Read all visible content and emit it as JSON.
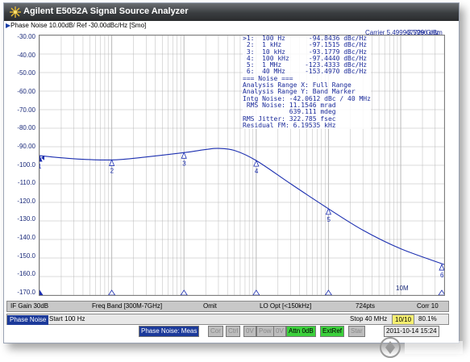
{
  "window": {
    "title": "Agilent E5052A Signal Source Analyzer"
  },
  "header": {
    "trace_label": "Phase Noise 10.00dB/ Ref -30.00dBc/Hz [Smo]"
  },
  "carrier": {
    "text": "Carrier 5.499967729 GHz",
    "power": "-3.5966 dBm"
  },
  "y_axis": {
    "ticks": [
      "-30.00",
      "-40.00",
      "-50.00",
      "-60.00",
      "-70.00",
      "-80.00",
      "-90.00",
      "-100.0",
      "-110.0",
      "-120.0",
      "-130.0",
      "-140.0",
      "-150.0",
      "-160.0",
      "-170.0"
    ]
  },
  "x_axis": {
    "tick_10M": "10M"
  },
  "readout_lines": [
    ">1:  100 Hz      -94.8436 dBc/Hz",
    " 2:  1 kHz       -97.1515 dBc/Hz",
    " 3:  10 kHz      -93.1779 dBc/Hz",
    " 4:  100 kHz     -97.4440 dBc/Hz",
    " 5:  1 MHz      -123.4333 dBc/Hz",
    " 6:  40 MHz     -153.4970 dBc/Hz",
    "=== Noise ===",
    "Analysis Range X: Full Range",
    "Analysis Range Y: Band Marker",
    "Intg Noise: -42.0612 dBc / 40 MHz",
    " RMS Noise: 11.1546 mrad",
    "            639.111 mdeg",
    "RMS Jitter: 322.785 fsec",
    "Residual FM: 6.19535 kHz"
  ],
  "markers": {
    "labels": [
      "1",
      "2",
      "3",
      "4",
      "5",
      "6"
    ],
    "offsets_hz": [
      100,
      1000,
      10000,
      100000,
      1000000,
      40000000
    ],
    "values_dbc": [
      -94.8436,
      -97.1515,
      -93.1779,
      -97.444,
      -123.4333,
      -153.497
    ]
  },
  "softkeys": {
    "if_gain": "IF Gain 30dB",
    "freq_band": "Freq Band [300M-7GHz]",
    "omit": "Omit",
    "lo_opt": "LO Opt [<150kHz]",
    "points": "724pts",
    "corr": "Corr 10"
  },
  "status_a": {
    "mode": "Phase Noise",
    "start": "Start 100 Hz",
    "stop": "Stop 40 MHz",
    "avg": "10/10",
    "percent": "80.1%"
  },
  "status_b": {
    "meas": "Phase Noise: Meas",
    "cor": "Cor",
    "ctrl": "Ctrl",
    "ov1": "0V",
    "pow": "Pow",
    "ov2": "0V",
    "attn": "Attn 0dB",
    "extref": "ExtRef",
    "star": "Star",
    "datetime": "2011-10-14 15:24"
  },
  "colors": {
    "trace": "#1c2fb0",
    "grid": "#b8b8b8",
    "accent_green": "#3cd03c",
    "accent_yellow": "#f7f070"
  }
}
